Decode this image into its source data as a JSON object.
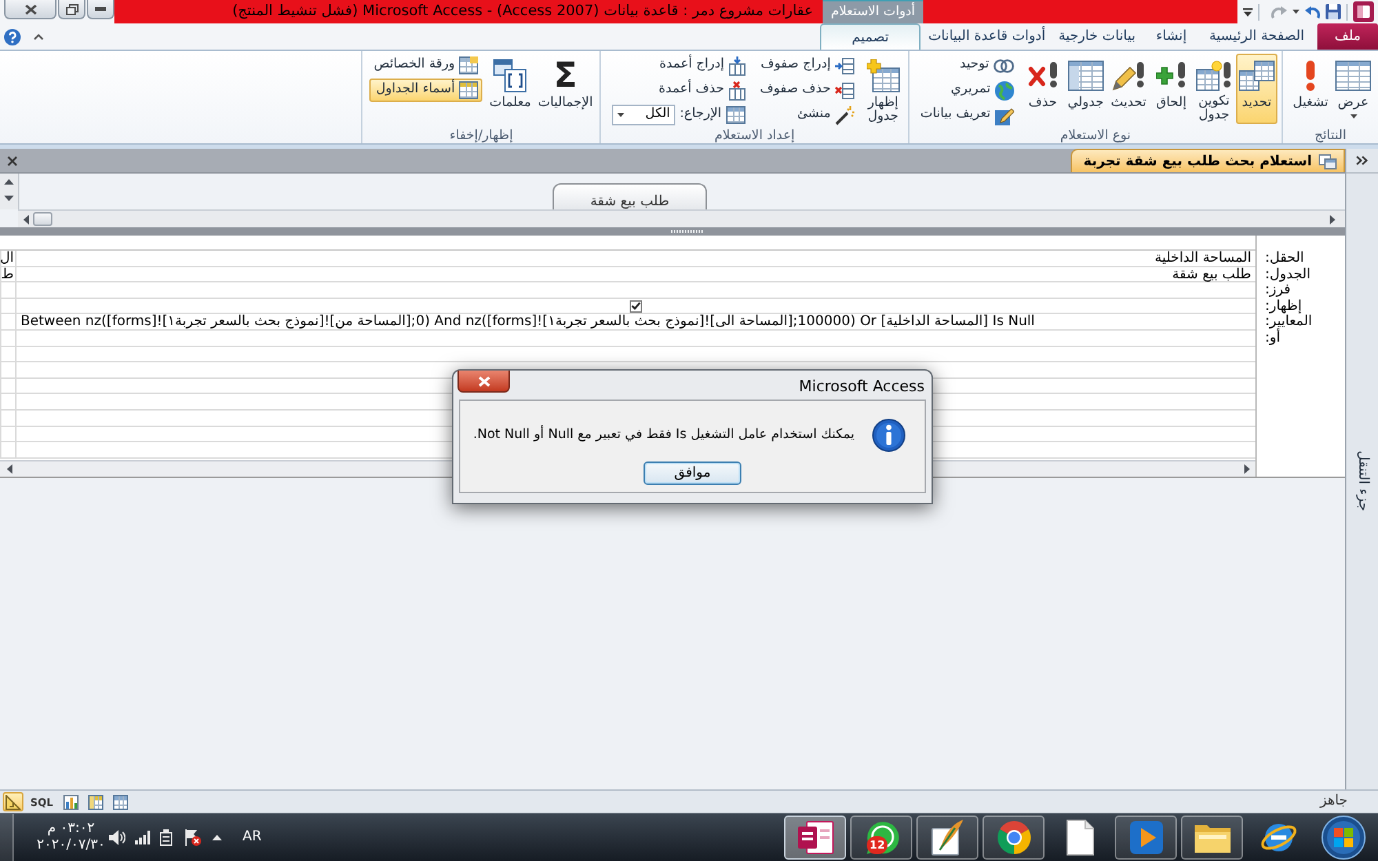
{
  "window": {
    "title": "عقارات مشروع دمر : قاعدة بيانات (Access 2007) - Microsoft Access (فشل تنشيط المنتج)",
    "contextual_tab_group": "أدوات الاستعلام"
  },
  "ribbon": {
    "tabs": [
      {
        "label": "ملف",
        "kind": "file",
        "selected": false
      },
      {
        "label": "الصفحة الرئيسية",
        "kind": "tab",
        "selected": false
      },
      {
        "label": "إنشاء",
        "kind": "tab",
        "selected": false
      },
      {
        "label": "بيانات خارجية",
        "kind": "tab",
        "selected": false
      },
      {
        "label": "أدوات قاعدة البيانات",
        "kind": "tab",
        "selected": false
      },
      {
        "label": "تصميم",
        "kind": "contextual",
        "selected": true
      }
    ],
    "groups": [
      {
        "label": "النتائج",
        "items": [
          {
            "kind": "large",
            "label": "عرض",
            "dropdown": true
          },
          {
            "kind": "large",
            "label": "تشغيل"
          }
        ]
      },
      {
        "label": "نوع الاستعلام",
        "items": [
          {
            "kind": "large",
            "label": "تحديد",
            "selected": true
          },
          {
            "kind": "large",
            "label": "تكوين جدول",
            "selected": false
          },
          {
            "kind": "large",
            "label": "إلحاق",
            "selected": false
          },
          {
            "kind": "large",
            "label": "تحديث",
            "selected": false
          },
          {
            "kind": "large",
            "label": "جدولي",
            "selected": false
          },
          {
            "kind": "large",
            "label": "حذف",
            "selected": false
          },
          {
            "kind": "stack",
            "items": [
              {
                "kind": "small",
                "label": "توحيد",
                "selected": false
              },
              {
                "kind": "small",
                "label": "تمريري",
                "selected": false
              },
              {
                "kind": "small",
                "label": "تعريف بيانات",
                "selected": false
              }
            ]
          }
        ]
      },
      {
        "label": "إعداد الاستعلام",
        "items": [
          {
            "kind": "large",
            "label": "إظهار جدول"
          },
          {
            "kind": "stack",
            "items": [
              {
                "kind": "small",
                "label": "إدراج صفوف"
              },
              {
                "kind": "small",
                "label": "حذف صفوف"
              },
              {
                "kind": "small",
                "label": "منشئ"
              }
            ]
          },
          {
            "kind": "stack",
            "items": [
              {
                "kind": "small",
                "label": "إدراج أعمدة"
              },
              {
                "kind": "small",
                "label": "حذف أعمدة"
              },
              {
                "kind": "dropdown",
                "label": "الإرجاع:",
                "value": "الكل"
              }
            ]
          }
        ]
      },
      {
        "label": "إظهار/إخفاء",
        "items": [
          {
            "kind": "large",
            "label": "الإجماليات",
            "symbol": "Σ",
            "on": false
          },
          {
            "kind": "large",
            "label": "معلمات"
          },
          {
            "kind": "stack",
            "items": [
              {
                "kind": "small",
                "label": "ورقة الخصائص",
                "on": false
              },
              {
                "kind": "small",
                "label": "أسماء الجداول",
                "on": true
              }
            ]
          }
        ]
      }
    ]
  },
  "document_tab": {
    "label": "استعلام بحث طلب بيع شقة تجربة"
  },
  "table_pane": {
    "tables": [
      {
        "name": "طلب بيع شقة"
      }
    ]
  },
  "design_grid": {
    "row_labels": [
      "الحقل:",
      "الجدول:",
      "فرز:",
      "إظهار:",
      "المعايير:",
      "أو:"
    ],
    "columns": [
      {
        "field": "المساحة الداخلية",
        "table": "طلب بيع شقة",
        "show": true,
        "criteria": "Between nz([forms]![نموذج بحث بالسعر تجربة١]![المساحة من];0) And nz([forms]![نموذج بحث بالسعر تجربة١]![المساحة الى];100000) Or [المساحة الداخلية] Is Null"
      },
      {
        "field": "ال",
        "table": "ط"
      }
    ]
  },
  "navigation_pane": {
    "label": "جزء التنقل"
  },
  "status_bar": {
    "text": "جاهز",
    "views": [
      {
        "kind": "icon",
        "selected": false
      },
      {
        "kind": "icon",
        "selected": false
      },
      {
        "kind": "icon",
        "selected": false
      },
      {
        "kind": "text",
        "label": "SQL",
        "selected": false
      },
      {
        "kind": "icon",
        "selected": true
      }
    ]
  },
  "taskbar": {
    "apps": [
      {
        "running": false,
        "active": false
      },
      {
        "running": true,
        "active": false
      },
      {
        "running": true,
        "active": false
      },
      {
        "running": false,
        "active": false
      },
      {
        "running": true,
        "active": false
      },
      {
        "running": true,
        "active": false
      },
      {
        "running": true,
        "active": false,
        "badge": "12"
      },
      {
        "running": true,
        "active": true
      }
    ],
    "language": "AR",
    "clock": {
      "time": "٠٣:٠٢ م",
      "date": "٢٠٢٠/٠٧/٣٠"
    }
  },
  "dialog": {
    "title": "Microsoft Access",
    "message": "يمكنك استخدام عامل التشغيل Is فقط في تعبير مع Null أو Not Null.",
    "buttons": [
      "موافق"
    ]
  }
}
